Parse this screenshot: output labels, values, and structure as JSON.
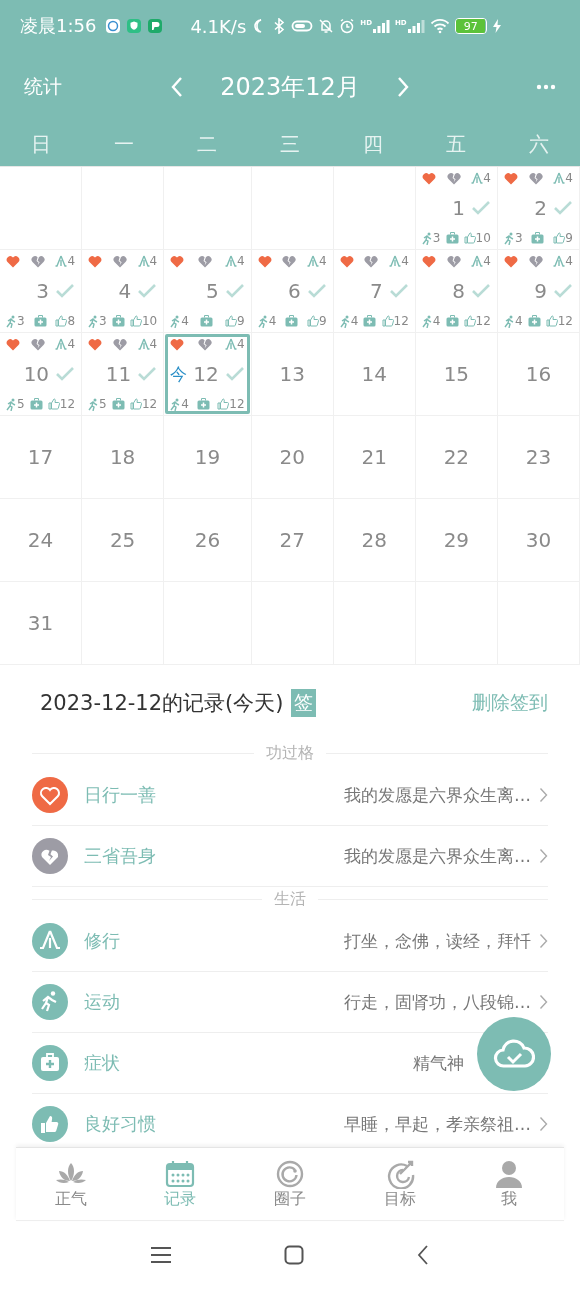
{
  "status_bar": {
    "time": "凌晨1:56",
    "speed": "4.1K/s",
    "signals": [
      {
        "label": "HD"
      },
      {
        "label": "HD"
      }
    ],
    "battery": "97"
  },
  "header": {
    "left": "统计",
    "month": "2023年12月"
  },
  "weekdays": [
    "日",
    "一",
    "二",
    "三",
    "四",
    "五",
    "六"
  ],
  "weeks": [
    [
      {
        "kind": "blank"
      },
      {
        "kind": "blank"
      },
      {
        "kind": "blank"
      },
      {
        "kind": "blank"
      },
      {
        "kind": "blank"
      },
      {
        "kind": "record",
        "day": "1",
        "practice": "4",
        "exercise": "3",
        "habit": "10",
        "checked": true,
        "today": false
      },
      {
        "kind": "record",
        "day": "2",
        "practice": "4",
        "exercise": "3",
        "habit": "9",
        "checked": true,
        "today": false
      }
    ],
    [
      {
        "kind": "record",
        "day": "3",
        "practice": "4",
        "exercise": "3",
        "habit": "8",
        "checked": true,
        "today": false
      },
      {
        "kind": "record",
        "day": "4",
        "practice": "4",
        "exercise": "3",
        "habit": "10",
        "checked": true,
        "today": false
      },
      {
        "kind": "record",
        "day": "5",
        "practice": "4",
        "exercise": "4",
        "habit": "9",
        "checked": true,
        "today": false
      },
      {
        "kind": "record",
        "day": "6",
        "practice": "4",
        "exercise": "4",
        "habit": "9",
        "checked": true,
        "today": false
      },
      {
        "kind": "record",
        "day": "7",
        "practice": "4",
        "exercise": "4",
        "habit": "12",
        "checked": true,
        "today": false
      },
      {
        "kind": "record",
        "day": "8",
        "practice": "4",
        "exercise": "4",
        "habit": "12",
        "checked": true,
        "today": false
      },
      {
        "kind": "record",
        "day": "9",
        "practice": "4",
        "exercise": "4",
        "habit": "12",
        "checked": true,
        "today": false
      }
    ],
    [
      {
        "kind": "record",
        "day": "10",
        "practice": "4",
        "exercise": "5",
        "habit": "12",
        "checked": true,
        "today": false
      },
      {
        "kind": "record",
        "day": "11",
        "practice": "4",
        "exercise": "5",
        "habit": "12",
        "checked": true,
        "today": false
      },
      {
        "kind": "record",
        "day": "12",
        "practice": "4",
        "exercise": "4",
        "habit": "12",
        "checked": true,
        "today": true,
        "mark": "今"
      },
      {
        "kind": "plain",
        "day": "13",
        "today": false
      },
      {
        "kind": "plain",
        "day": "14",
        "today": false
      },
      {
        "kind": "plain",
        "day": "15",
        "today": false
      },
      {
        "kind": "plain",
        "day": "16",
        "today": false
      }
    ],
    [
      {
        "kind": "plain",
        "day": "17",
        "today": false
      },
      {
        "kind": "plain",
        "day": "18",
        "today": false
      },
      {
        "kind": "plain",
        "day": "19",
        "today": false
      },
      {
        "kind": "plain",
        "day": "20",
        "today": false
      },
      {
        "kind": "plain",
        "day": "21",
        "today": false
      },
      {
        "kind": "plain",
        "day": "22",
        "today": false
      },
      {
        "kind": "plain",
        "day": "23",
        "today": false
      }
    ],
    [
      {
        "kind": "plain",
        "day": "24",
        "today": false
      },
      {
        "kind": "plain",
        "day": "25",
        "today": false
      },
      {
        "kind": "plain",
        "day": "26",
        "today": false
      },
      {
        "kind": "plain",
        "day": "27",
        "today": false
      },
      {
        "kind": "plain",
        "day": "28",
        "today": false
      },
      {
        "kind": "plain",
        "day": "29",
        "today": false
      },
      {
        "kind": "plain",
        "day": "30",
        "today": false
      }
    ],
    [
      {
        "kind": "plain",
        "day": "31",
        "today": false
      },
      {
        "kind": "blank"
      },
      {
        "kind": "blank"
      },
      {
        "kind": "blank"
      },
      {
        "kind": "blank"
      },
      {
        "kind": "blank"
      },
      {
        "kind": "blank"
      }
    ]
  ],
  "record": {
    "title": "2023-12-12的记录(今天)",
    "badge": "签",
    "action": "删除签到",
    "sections": [
      {
        "title": "功过格",
        "items": [
          {
            "kind": "heart",
            "color": "#ef6a45",
            "label": "日行一善",
            "value": "我的发愿是六界众生离…",
            "obscured": false
          },
          {
            "kind": "broken-heart",
            "color": "#9d9ca5",
            "label": "三省吾身",
            "value": "我的发愿是六界众生离…",
            "obscured": false
          }
        ]
      },
      {
        "title": "生活",
        "items": [
          {
            "kind": "practice",
            "color": "#7dbcb3",
            "label": "修行",
            "value": "打坐，念佛，读经，拜忏",
            "obscured": false
          },
          {
            "kind": "runner",
            "color": "#7dbcb3",
            "label": "运动",
            "value": "行走，固肾功，八段锦…",
            "obscured": false
          },
          {
            "kind": "medkit",
            "color": "#7dbcb3",
            "label": "症状",
            "value": "精气神",
            "obscured": true
          },
          {
            "kind": "thumb",
            "color": "#7dbcb3",
            "label": "良好习惯",
            "value": "早睡，早起，孝亲祭祖…",
            "obscured": false
          }
        ]
      }
    ]
  },
  "tabs": [
    {
      "kind": "lotus",
      "label": "正气",
      "selected": false
    },
    {
      "kind": "calendar",
      "label": "记录",
      "selected": true
    },
    {
      "kind": "ring",
      "label": "圈子",
      "selected": false
    },
    {
      "kind": "target",
      "label": "目标",
      "selected": false
    },
    {
      "kind": "person",
      "label": "我",
      "selected": false
    }
  ]
}
